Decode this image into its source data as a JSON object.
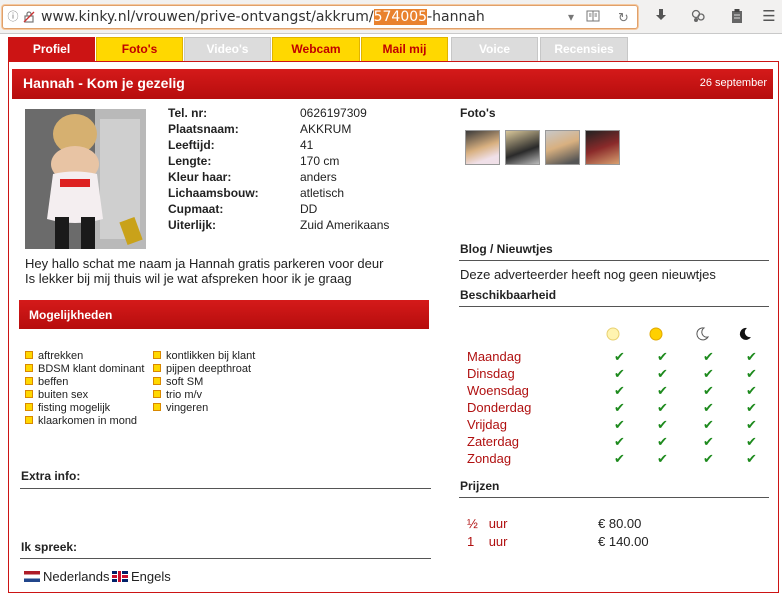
{
  "browser": {
    "url_prefix": "www.kinky.nl/vrouwen/prive-ontvangst/akkrum/",
    "url_highlight": "574005",
    "url_suffix": "-hannah"
  },
  "tabs": [
    {
      "label": "Profiel",
      "state": "active"
    },
    {
      "label": "Foto's",
      "state": "yellow"
    },
    {
      "label": "Video's",
      "state": "gray"
    },
    {
      "label": "Webcam",
      "state": "yellow"
    },
    {
      "label": "Mail mij",
      "state": "yellow"
    },
    {
      "label": "Voice",
      "state": "gray"
    },
    {
      "label": "Recensies",
      "state": "gray"
    }
  ],
  "header": {
    "title": "Hannah - Kom je gezelig",
    "date": "26 september"
  },
  "profile": {
    "rows": [
      {
        "label": "Tel. nr:",
        "value": "0626197309"
      },
      {
        "label": "Plaatsnaam:",
        "value": "AKKRUM"
      },
      {
        "label": "Leeftijd:",
        "value": "41"
      },
      {
        "label": "Lengte:",
        "value": "170 cm"
      },
      {
        "label": "Kleur haar:",
        "value": "anders"
      },
      {
        "label": "Lichaamsbouw:",
        "value": "atletisch"
      },
      {
        "label": "Cupmaat:",
        "value": "DD"
      },
      {
        "label": "Uiterlijk:",
        "value": "Zuid Amerikaans"
      }
    ],
    "description_line1": "Hey hallo schat me naam ja Hannah gratis parkeren voor deur",
    "description_line2": "Is lekker bij mij thuis wil je wat afspreken hoor ik je graag"
  },
  "mogelijkheden": {
    "title": "Mogelijkheden",
    "col1": [
      "aftrekken",
      "BDSM klant dominant",
      "beffen",
      "buiten sex",
      "fisting mogelijk",
      "klaarkomen in mond"
    ],
    "col2": [
      "kontlikken bij klant",
      "pijpen deepthroat",
      "soft SM",
      "trio m/v",
      "vingeren"
    ]
  },
  "extra_info": {
    "title": "Extra info:"
  },
  "languages": {
    "title": "Ik spreek:",
    "items": [
      {
        "flag": "nl-flag",
        "label": "Nederlands"
      },
      {
        "flag": "uk-flag",
        "label": "Engels"
      }
    ]
  },
  "fotos": {
    "title": "Foto's"
  },
  "blog": {
    "title": "Blog / Nieuwtjes",
    "text": "Deze adverteerder heeft nog geen nieuwtjes"
  },
  "beschikbaarheid": {
    "title": "Beschikbaarheid",
    "icons": [
      "morning-sun-icon",
      "afternoon-sun-icon",
      "evening-moon-icon",
      "night-moon-icon"
    ],
    "days": [
      "Maandag",
      "Dinsdag",
      "Woensdag",
      "Donderdag",
      "Vrijdag",
      "Zaterdag",
      "Zondag"
    ],
    "check_symbol": "✔"
  },
  "prijzen": {
    "title": "Prijzen",
    "items": [
      {
        "qty": "½",
        "unit": "uur",
        "price": "€ 80.00"
      },
      {
        "qty": "1",
        "unit": "uur",
        "price": "€ 140.00"
      }
    ]
  },
  "colors": {
    "accent": "#cc1414",
    "tab_yellow": "#ffd800",
    "day_text": "#b01010",
    "check": "#1d8a1d"
  }
}
